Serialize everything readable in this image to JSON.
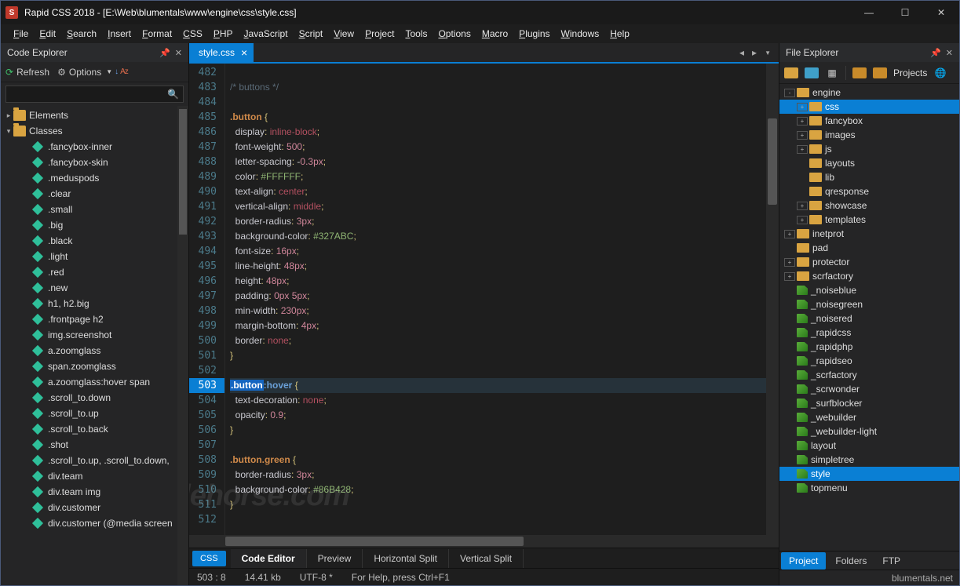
{
  "title": "Rapid CSS 2018 - [E:\\Web\\blumentals\\www\\engine\\css\\style.css]",
  "menus": [
    "File",
    "Edit",
    "Search",
    "Insert",
    "Format",
    "CSS",
    "PHP",
    "JavaScript",
    "Script",
    "View",
    "Project",
    "Tools",
    "Options",
    "Macro",
    "Plugins",
    "Windows",
    "Help"
  ],
  "codeExplorer": {
    "title": "Code Explorer",
    "refresh": "Refresh",
    "options": "Options",
    "elements": "Elements",
    "classesLabel": "Classes",
    "classes": [
      ".fancybox-inner",
      ".fancybox-skin",
      ".meduspods",
      ".clear",
      ".small",
      ".big",
      ".black",
      ".light",
      ".red",
      ".new",
      "h1, h2.big",
      ".frontpage h2",
      "img.screenshot",
      "a.zoomglass",
      "span.zoomglass",
      "a.zoomglass:hover span",
      ".scroll_to.down",
      ".scroll_to.up",
      ".scroll_to.back",
      ".shot",
      ".scroll_to.up, .scroll_to.down,",
      "div.team",
      "div.team img",
      "div.customer",
      "div.customer (@media screen"
    ]
  },
  "tab": {
    "name": "style.css"
  },
  "code": {
    "start": 482,
    "highlight": 503,
    "lines": [
      "",
      "/* buttons */",
      "",
      ".button {",
      "  display: inline-block;",
      "  font-weight: 500;",
      "  letter-spacing: -0.3px;",
      "  color: #FFFFFF;",
      "  text-align: center;",
      "  vertical-align: middle;",
      "  border-radius: 3px;",
      "  background-color: #327ABC;",
      "  font-size: 16px;",
      "  line-height: 48px;",
      "  height: 48px;",
      "  padding: 0px 5px;",
      "  min-width: 230px;",
      "  margin-bottom: 4px;",
      "  border: none;",
      "}",
      "",
      ".button:hover {",
      "  text-decoration: none;",
      "  opacity: 0.9;",
      "}",
      "",
      ".button.green {",
      "  border-radius: 3px;",
      "  background-color: #86B428;",
      "}",
      ""
    ]
  },
  "leftPill": "CSS",
  "bottomTabs": [
    "Code Editor",
    "Preview",
    "Horizontal Split",
    "Vertical Split"
  ],
  "status": {
    "pos": "503 : 8",
    "size": "14.41 kb",
    "enc": "UTF-8 *",
    "help": "For Help, press Ctrl+F1"
  },
  "fileExplorer": {
    "title": "File Explorer",
    "projects": "Projects",
    "tree": [
      {
        "d": 0,
        "exp": "-",
        "ico": "folder",
        "name": "engine"
      },
      {
        "d": 1,
        "exp": "+",
        "ico": "folder",
        "name": "css",
        "sel": true
      },
      {
        "d": 1,
        "exp": "+",
        "ico": "folder",
        "name": "fancybox"
      },
      {
        "d": 1,
        "exp": "+",
        "ico": "folder",
        "name": "images"
      },
      {
        "d": 1,
        "exp": "+",
        "ico": "folder",
        "name": "js"
      },
      {
        "d": 1,
        "exp": "",
        "ico": "folder",
        "name": "layouts"
      },
      {
        "d": 1,
        "exp": "",
        "ico": "folder",
        "name": "lib"
      },
      {
        "d": 1,
        "exp": "",
        "ico": "folder",
        "name": "qresponse"
      },
      {
        "d": 1,
        "exp": "+",
        "ico": "folder",
        "name": "showcase"
      },
      {
        "d": 1,
        "exp": "+",
        "ico": "folder",
        "name": "templates"
      },
      {
        "d": 0,
        "exp": "+",
        "ico": "folder",
        "name": "inetprot"
      },
      {
        "d": 0,
        "exp": "",
        "ico": "folder",
        "name": "pad"
      },
      {
        "d": 0,
        "exp": "+",
        "ico": "folder",
        "name": "protector"
      },
      {
        "d": 0,
        "exp": "+",
        "ico": "folder",
        "name": "scrfactory"
      },
      {
        "d": 0,
        "exp": "",
        "ico": "html",
        "name": "_noiseblue"
      },
      {
        "d": 0,
        "exp": "",
        "ico": "html",
        "name": "_noisegreen"
      },
      {
        "d": 0,
        "exp": "",
        "ico": "html",
        "name": "_noisered"
      },
      {
        "d": 0,
        "exp": "",
        "ico": "html",
        "name": "_rapidcss"
      },
      {
        "d": 0,
        "exp": "",
        "ico": "html",
        "name": "_rapidphp"
      },
      {
        "d": 0,
        "exp": "",
        "ico": "html",
        "name": "_rapidseo"
      },
      {
        "d": 0,
        "exp": "",
        "ico": "html",
        "name": "_scrfactory"
      },
      {
        "d": 0,
        "exp": "",
        "ico": "html",
        "name": "_scrwonder"
      },
      {
        "d": 0,
        "exp": "",
        "ico": "html",
        "name": "_surfblocker"
      },
      {
        "d": 0,
        "exp": "",
        "ico": "html",
        "name": "_webuilder"
      },
      {
        "d": 0,
        "exp": "",
        "ico": "html",
        "name": "_webuilder-light"
      },
      {
        "d": 0,
        "exp": "",
        "ico": "html",
        "name": "layout"
      },
      {
        "d": 0,
        "exp": "",
        "ico": "html",
        "name": "simpletree"
      },
      {
        "d": 0,
        "exp": "",
        "ico": "html",
        "name": "style",
        "sel2": true
      },
      {
        "d": 0,
        "exp": "",
        "ico": "html",
        "name": "topmenu"
      }
    ],
    "bottomTabs": [
      "Project",
      "Folders",
      "FTP"
    ],
    "status": "blumentals.net"
  },
  "watermark": "filehorse.com"
}
